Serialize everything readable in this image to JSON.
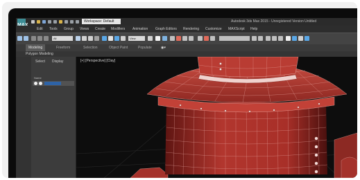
{
  "titlebar": {
    "workspace": "Workspace: Default",
    "app_title": "Autodesk 3ds Max 2015 - Unregistered Version  Untitled",
    "logo": "MAX"
  },
  "menu": [
    "Edit",
    "Tools",
    "Group",
    "Views",
    "Create",
    "Modifiers",
    "Animation",
    "Graph Editors",
    "Rendering",
    "Customize",
    "MAXScript",
    "Help"
  ],
  "toolbar": {
    "selection_filter": "All",
    "reference_coord": "View"
  },
  "ribbon": {
    "tabs": [
      "Modeling",
      "Freeform",
      "Selection",
      "Object Paint",
      "Populate"
    ],
    "active_tab": "Modeling",
    "panel_label": "Polygon Modeling"
  },
  "explorer": {
    "tabs": [
      "Select",
      "Display"
    ],
    "column_header": "Name"
  },
  "viewport": {
    "label": "[+] [Perspective] [Clay]"
  },
  "colors": {
    "model_red": "#b2362e",
    "wire": "#e7a8a2",
    "viewport_bg": "#0d0d0d",
    "ui_dark": "#3a3a3a",
    "accent_teal": "#3d8d95"
  }
}
